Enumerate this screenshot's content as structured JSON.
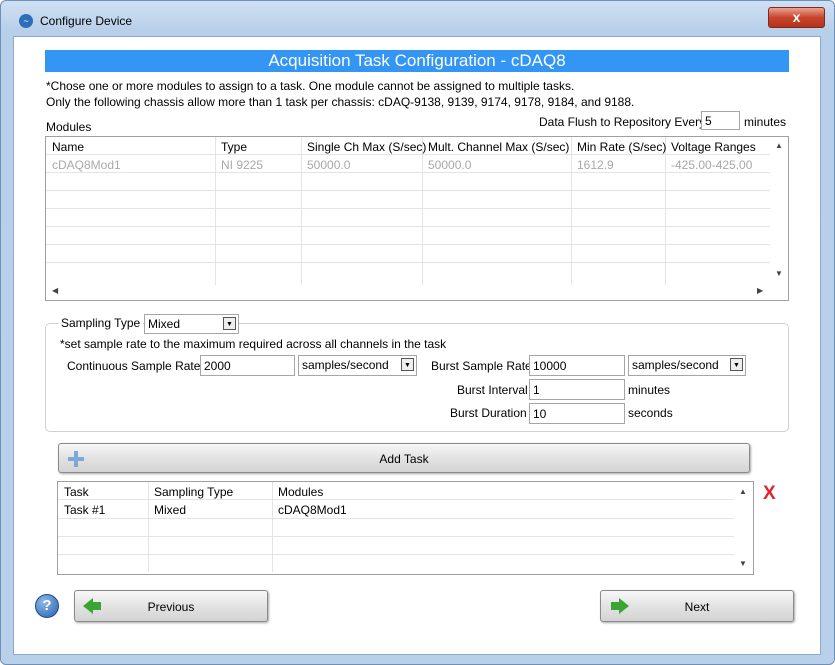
{
  "window": {
    "title": "Configure Device",
    "close_glyph": "x"
  },
  "header": {
    "title": "Acquisition Task Configuration - cDAQ8"
  },
  "notes": {
    "line1": "*Chose one or more modules to assign to a task.  One module cannot be assigned to multiple tasks.",
    "line2": "Only the following chassis allow more than 1 task per chassis: cDAQ-9138, 9139, 9174, 9178, 9184, and 9188."
  },
  "modules": {
    "label": "Modules",
    "columns": [
      "Name",
      "Type",
      "Single Ch Max (S/sec)",
      "Mult. Channel Max (S/sec)",
      "Min Rate (S/sec)",
      "Voltage Ranges"
    ],
    "rows": [
      [
        "cDAQ8Mod1",
        "NI 9225",
        "50000.0",
        "50000.0",
        "1612.9",
        "-425.00-425.00"
      ]
    ]
  },
  "data_flush": {
    "label": "Data Flush to Repository Every",
    "value": "5",
    "unit": "minutes"
  },
  "sampling": {
    "type_label": "Sampling Type",
    "type_value": "Mixed",
    "note": "*set sample rate to the maximum required across all channels in the task",
    "continuous_label": "Continuous Sample Rate",
    "continuous_value": "2000",
    "continuous_unit": "samples/second",
    "burst_rate_label": "Burst Sample Rate",
    "burst_rate_value": "10000",
    "burst_rate_unit": "samples/second",
    "burst_interval_label": "Burst Interval",
    "burst_interval_value": "1",
    "burst_interval_unit": "minutes",
    "burst_duration_label": "Burst Duration",
    "burst_duration_value": "10",
    "burst_duration_unit": "seconds"
  },
  "add_task": {
    "label": "Add Task"
  },
  "tasks": {
    "columns": [
      "Task",
      "Sampling Type",
      "Modules"
    ],
    "rows": [
      [
        "Task #1",
        "Mixed",
        "cDAQ8Mod1"
      ]
    ]
  },
  "delete_glyph": "X",
  "help_glyph": "?",
  "nav": {
    "previous": "Previous",
    "next": "Next"
  },
  "colors": {
    "header_bg": "#3396f5",
    "delete_red": "#e0262b",
    "arrow_green": "#3aa435"
  }
}
